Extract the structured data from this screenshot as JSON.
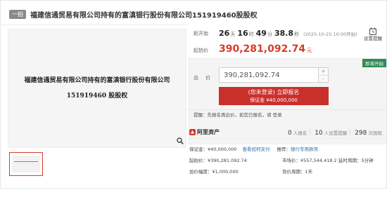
{
  "header": {
    "tag": "一拍",
    "title": "福建信通贸易有限公司持有的富滇银行股份有限公司151919460股股权"
  },
  "image": {
    "caption": "福建信通贸易有限公司持有的富滇银行股份有限公司 151919460 股股权"
  },
  "countdown": {
    "label": "距开始",
    "days": "26",
    "days_unit": "天",
    "hours": "16",
    "hours_unit": "时",
    "minutes": "49",
    "minutes_unit": "分",
    "seconds": "38.8",
    "seconds_unit": "秒",
    "note": "(2025-10-25 10:00开拍)"
  },
  "remind": {
    "label": "设置提醒"
  },
  "start_price": {
    "label": "起拍价",
    "value": "390,281,092.74",
    "unit": "元"
  },
  "bid": {
    "badge": "即将开拍",
    "label": "出 价",
    "value": "390,281,092.74",
    "plus": "+",
    "minus": "-",
    "button_line1": "(您未登录) 立即报名",
    "button_line2": "保证金 ¥40,000,000",
    "tip": "提醒：先报名再出价。如您已报名，请 登录"
  },
  "platform": {
    "name": "阿里资产",
    "enrolled_count": "0",
    "enrolled_unit": "人报名",
    "reminders_count": "10",
    "reminders_unit": "人设置提醒",
    "views_count": "298",
    "views_unit": "次围观"
  },
  "details": {
    "deposit_label": "保证金：",
    "deposit_value": "¥40,000,000",
    "deposit_link": "查看如何支付",
    "recommend_label": "推荐：",
    "recommend_link": "银行专用款项",
    "start_price_label": "起拍价：",
    "start_price_value": "¥390,281,092.74",
    "market_price_label": "市场价：",
    "market_price_value": "¥557,544,418.2",
    "delay_label": "延时周期：",
    "delay_value": "5分钟",
    "increment_label": "加价幅度：",
    "increment_value": "¥1,000,000",
    "cycle_label": "竞价周期：",
    "cycle_value": "1天"
  },
  "colors": {
    "accent": "#d63c2a",
    "button": "#c9302c",
    "badge": "#2e8b57",
    "link": "#2b6cb0"
  },
  "icons": {
    "remind": "bell-clock-icon",
    "zoom": "magnifier-icon",
    "platform_logo": "ali-assets-logo-icon"
  }
}
